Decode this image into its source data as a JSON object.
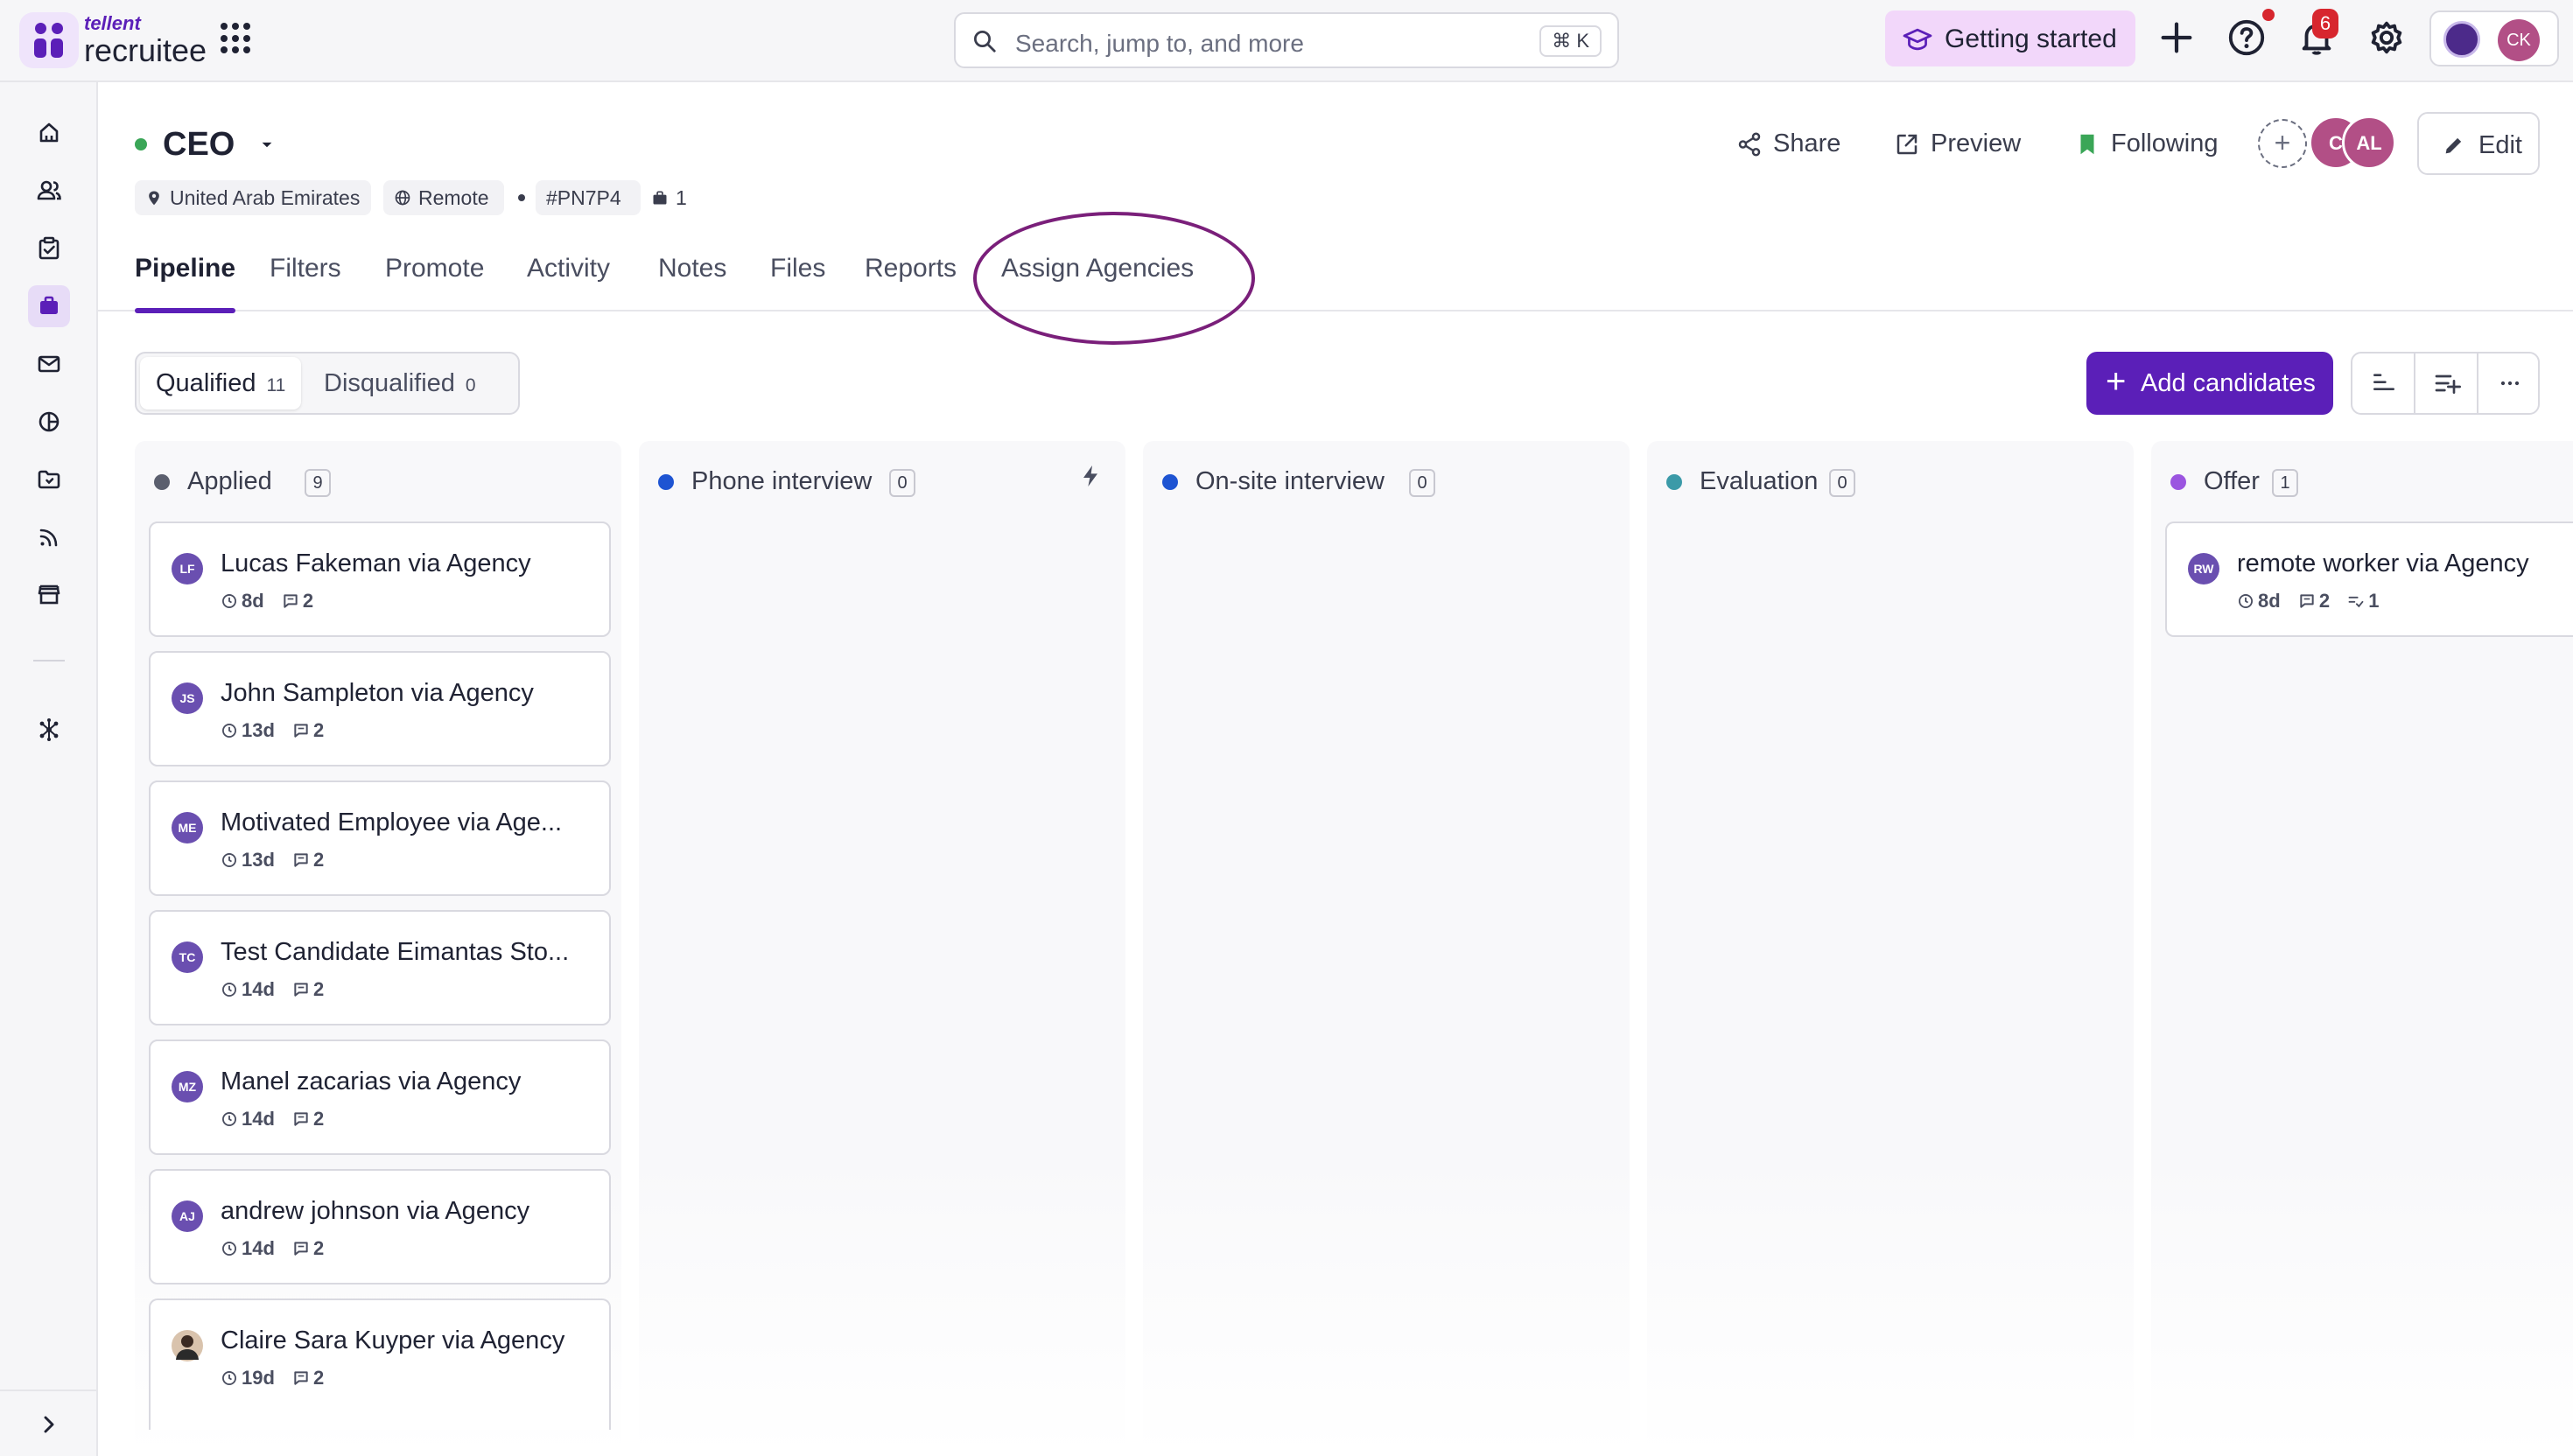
{
  "brand": {
    "small": "tellent",
    "main": "recruitee"
  },
  "search": {
    "placeholder": "Search, jump to, and more",
    "shortcut": "⌘ K"
  },
  "topbar": {
    "getting_started": "Getting started",
    "notifications_count": "6",
    "user_initials": "CK"
  },
  "job": {
    "title": "CEO",
    "location": "United Arab Emirates",
    "remote": "Remote",
    "code": "#PN7P4",
    "openings": "1"
  },
  "actions": {
    "share": "Share",
    "preview": "Preview",
    "following": "Following",
    "edit": "Edit"
  },
  "followers": [
    {
      "initials": "C"
    },
    {
      "initials": "AL"
    }
  ],
  "tabs": [
    "Pipeline",
    "Filters",
    "Promote",
    "Activity",
    "Notes",
    "Files",
    "Reports",
    "Assign Agencies"
  ],
  "filter": {
    "qualified": "Qualified",
    "qualified_count": "11",
    "disqualified": "Disqualified",
    "disqualified_count": "0"
  },
  "add_candidates": "Add candidates",
  "stages": [
    {
      "name": "Applied",
      "count": "9",
      "color": "#5b5f6e"
    },
    {
      "name": "Phone interview",
      "count": "0",
      "color": "#1e54d2"
    },
    {
      "name": "On-site interview",
      "count": "0",
      "color": "#1e54d2"
    },
    {
      "name": "Evaluation",
      "count": "0",
      "color": "#3b9aa8"
    },
    {
      "name": "Offer",
      "count": "1",
      "color": "#9b55e0"
    }
  ],
  "candidates_applied": [
    {
      "initials": "LF",
      "name": "Lucas Fakeman via Agency",
      "age": "8d",
      "comments": "2"
    },
    {
      "initials": "JS",
      "name": "John Sampleton via Agency",
      "age": "13d",
      "comments": "2"
    },
    {
      "initials": "ME",
      "name": "Motivated Employee via Age...",
      "age": "13d",
      "comments": "2"
    },
    {
      "initials": "TC",
      "name": "Test Candidate Eimantas Sto...",
      "age": "14d",
      "comments": "2"
    },
    {
      "initials": "MZ",
      "name": "Manel zacarias via Agency",
      "age": "14d",
      "comments": "2"
    },
    {
      "initials": "AJ",
      "name": "andrew johnson via Agency",
      "age": "14d",
      "comments": "2"
    },
    {
      "initials": "",
      "name": "Claire Sara Kuyper via Agency",
      "age": "19d",
      "comments": "2"
    }
  ],
  "candidates_offer": [
    {
      "initials": "RW",
      "name": "remote worker via Agency",
      "age": "8d",
      "comments": "2",
      "tasks": "1"
    }
  ]
}
